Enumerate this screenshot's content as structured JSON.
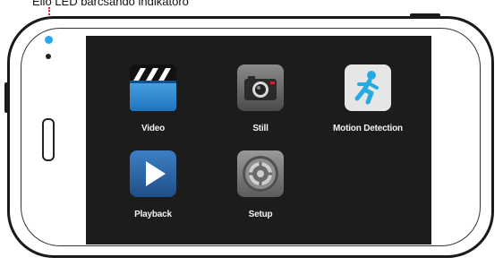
{
  "callout": {
    "text": "Ello LED barcsando indikatoro"
  },
  "screen": {
    "apps": [
      {
        "label": "Video",
        "icon": "clapperboard-icon"
      },
      {
        "label": "Still",
        "icon": "camera-icon"
      },
      {
        "label": "Motion Detection",
        "icon": "running-man-icon"
      },
      {
        "label": "Playback",
        "icon": "play-icon"
      },
      {
        "label": "Setup",
        "icon": "gear-icon"
      }
    ]
  },
  "colors": {
    "led": "#2aa7e6",
    "callout_line": "#e0192e",
    "screen_bg": "#1c1c1c"
  }
}
